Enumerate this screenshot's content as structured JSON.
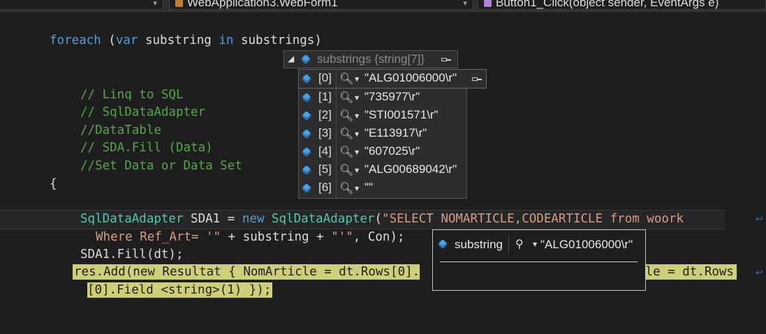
{
  "navbar": {
    "project_dropdown": "WebApplication3.WebForm1",
    "member_dropdown": "Button1_Click(object sender, EventArgs e)"
  },
  "code": {
    "l1_kw1": "foreach",
    "l1_p1": " (",
    "l1_kw2": "var",
    "l1_p2": " substring ",
    "l1_kw3": "in",
    "l1_p3": " substrings)",
    "c1": "// Linq to SQL",
    "c2": "// SqlDataAdapter",
    "c3": "//DataTable",
    "c4": "// SDA.Fill (Data)",
    "c5": "//Set Data or Data Set",
    "brace": "{",
    "l2_ty1": "SqlDataAdapter",
    "l2_p1": " SDA1 = ",
    "l2_kw": "new",
    "l2_sp": " ",
    "l2_ty2": "SqlDataAdapter",
    "l2_p2": "(",
    "l2_str1": "\"SELECT NOMARTICLE,CODEARTICLE from woork",
    "l3_str1": "Where Ref_Art= '\"",
    "l3_p1": " + substring + ",
    "l3_str2": "\"'\"",
    "l3_p2": ", Con);",
    "l4": "SDA1.Fill(dt);",
    "l5a": "res.Add(new Resultat { NomArticle = dt.Rows[0].",
    "l5b": "cle = dt.Rows",
    "l6": "[0].Field <string>(1) });"
  },
  "datatip": {
    "header_name": "substrings",
    "header_type": "{string[7]}",
    "items": [
      {
        "index": "[0]",
        "value": "\"ALG01006000\\r\""
      },
      {
        "index": "[1]",
        "value": "\"735977\\r\""
      },
      {
        "index": "[2]",
        "value": "\"STI001571\\r\""
      },
      {
        "index": "[3]",
        "value": "\"E113917\\r\""
      },
      {
        "index": "[4]",
        "value": "\"607025\\r\""
      },
      {
        "index": "[5]",
        "value": "\"ALG00689042\\r\""
      },
      {
        "index": "[6]",
        "value": "\"\""
      }
    ]
  },
  "quickinfo": {
    "name": "substring",
    "value": "\"ALG01006000\\r\""
  },
  "colors": {
    "editor_bg": "#1e1e1e",
    "keyword": "#569cd6",
    "type": "#4ec9b0",
    "string": "#d69d85",
    "comment": "#57a64a",
    "highlight": "#cfcf7a"
  }
}
